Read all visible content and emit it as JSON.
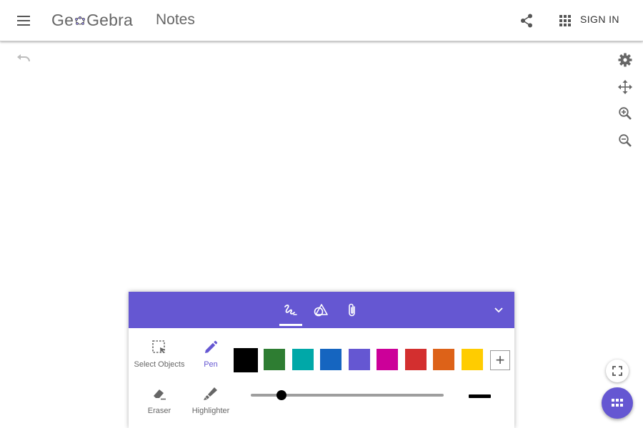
{
  "header": {
    "logo_text_left": "Ge",
    "logo_text_right": "Gebra",
    "app_name": "Notes",
    "sign_in_label": "SIGN IN",
    "icons": {
      "menu": "menu-icon",
      "share": "share-icon",
      "apps": "apps-grid-icon"
    }
  },
  "canvas": {
    "undo_icon": "undo-icon",
    "side_tools": [
      "settings-icon",
      "move-view-icon",
      "zoom-in-icon",
      "zoom-out-icon"
    ]
  },
  "toolbar": {
    "tabs": [
      {
        "icon": "pen-scribble-icon",
        "active": true
      },
      {
        "icon": "shapes-icon",
        "active": false
      },
      {
        "icon": "attachment-icon",
        "active": false
      }
    ],
    "tools": [
      {
        "label": "Select Objects",
        "icon": "select-objects-icon",
        "selected": false
      },
      {
        "label": "Pen",
        "icon": "pen-icon",
        "selected": true
      },
      {
        "label": "Eraser",
        "icon": "eraser-icon",
        "selected": false
      },
      {
        "label": "Highlighter",
        "icon": "highlighter-icon",
        "selected": false
      }
    ],
    "colors": [
      "#000000",
      "#2e7d32",
      "#00a8a8",
      "#1565c0",
      "#6557d2",
      "#cc0099",
      "#d32f2f",
      "#dd6218",
      "#ffcc00"
    ],
    "selected_color": "#000000",
    "add_color_label": "+",
    "pen_thickness_fraction": 0.16
  },
  "accent_color": "#6557d2"
}
